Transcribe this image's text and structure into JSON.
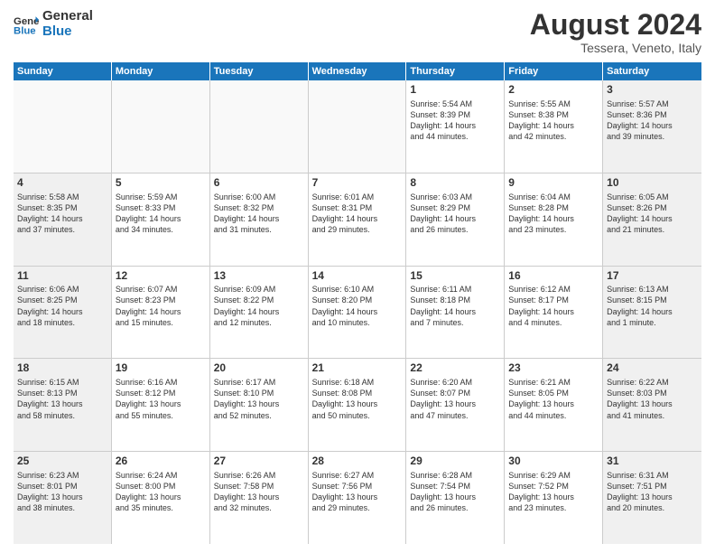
{
  "header": {
    "logo_line1": "General",
    "logo_line2": "Blue",
    "month_year": "August 2024",
    "location": "Tessera, Veneto, Italy"
  },
  "days": [
    "Sunday",
    "Monday",
    "Tuesday",
    "Wednesday",
    "Thursday",
    "Friday",
    "Saturday"
  ],
  "weeks": [
    [
      {
        "day": "",
        "content": ""
      },
      {
        "day": "",
        "content": ""
      },
      {
        "day": "",
        "content": ""
      },
      {
        "day": "",
        "content": ""
      },
      {
        "day": "1",
        "content": "Sunrise: 5:54 AM\nSunset: 8:39 PM\nDaylight: 14 hours\nand 44 minutes."
      },
      {
        "day": "2",
        "content": "Sunrise: 5:55 AM\nSunset: 8:38 PM\nDaylight: 14 hours\nand 42 minutes."
      },
      {
        "day": "3",
        "content": "Sunrise: 5:57 AM\nSunset: 8:36 PM\nDaylight: 14 hours\nand 39 minutes."
      }
    ],
    [
      {
        "day": "4",
        "content": "Sunrise: 5:58 AM\nSunset: 8:35 PM\nDaylight: 14 hours\nand 37 minutes."
      },
      {
        "day": "5",
        "content": "Sunrise: 5:59 AM\nSunset: 8:33 PM\nDaylight: 14 hours\nand 34 minutes."
      },
      {
        "day": "6",
        "content": "Sunrise: 6:00 AM\nSunset: 8:32 PM\nDaylight: 14 hours\nand 31 minutes."
      },
      {
        "day": "7",
        "content": "Sunrise: 6:01 AM\nSunset: 8:31 PM\nDaylight: 14 hours\nand 29 minutes."
      },
      {
        "day": "8",
        "content": "Sunrise: 6:03 AM\nSunset: 8:29 PM\nDaylight: 14 hours\nand 26 minutes."
      },
      {
        "day": "9",
        "content": "Sunrise: 6:04 AM\nSunset: 8:28 PM\nDaylight: 14 hours\nand 23 minutes."
      },
      {
        "day": "10",
        "content": "Sunrise: 6:05 AM\nSunset: 8:26 PM\nDaylight: 14 hours\nand 21 minutes."
      }
    ],
    [
      {
        "day": "11",
        "content": "Sunrise: 6:06 AM\nSunset: 8:25 PM\nDaylight: 14 hours\nand 18 minutes."
      },
      {
        "day": "12",
        "content": "Sunrise: 6:07 AM\nSunset: 8:23 PM\nDaylight: 14 hours\nand 15 minutes."
      },
      {
        "day": "13",
        "content": "Sunrise: 6:09 AM\nSunset: 8:22 PM\nDaylight: 14 hours\nand 12 minutes."
      },
      {
        "day": "14",
        "content": "Sunrise: 6:10 AM\nSunset: 8:20 PM\nDaylight: 14 hours\nand 10 minutes."
      },
      {
        "day": "15",
        "content": "Sunrise: 6:11 AM\nSunset: 8:18 PM\nDaylight: 14 hours\nand 7 minutes."
      },
      {
        "day": "16",
        "content": "Sunrise: 6:12 AM\nSunset: 8:17 PM\nDaylight: 14 hours\nand 4 minutes."
      },
      {
        "day": "17",
        "content": "Sunrise: 6:13 AM\nSunset: 8:15 PM\nDaylight: 14 hours\nand 1 minute."
      }
    ],
    [
      {
        "day": "18",
        "content": "Sunrise: 6:15 AM\nSunset: 8:13 PM\nDaylight: 13 hours\nand 58 minutes."
      },
      {
        "day": "19",
        "content": "Sunrise: 6:16 AM\nSunset: 8:12 PM\nDaylight: 13 hours\nand 55 minutes."
      },
      {
        "day": "20",
        "content": "Sunrise: 6:17 AM\nSunset: 8:10 PM\nDaylight: 13 hours\nand 52 minutes."
      },
      {
        "day": "21",
        "content": "Sunrise: 6:18 AM\nSunset: 8:08 PM\nDaylight: 13 hours\nand 50 minutes."
      },
      {
        "day": "22",
        "content": "Sunrise: 6:20 AM\nSunset: 8:07 PM\nDaylight: 13 hours\nand 47 minutes."
      },
      {
        "day": "23",
        "content": "Sunrise: 6:21 AM\nSunset: 8:05 PM\nDaylight: 13 hours\nand 44 minutes."
      },
      {
        "day": "24",
        "content": "Sunrise: 6:22 AM\nSunset: 8:03 PM\nDaylight: 13 hours\nand 41 minutes."
      }
    ],
    [
      {
        "day": "25",
        "content": "Sunrise: 6:23 AM\nSunset: 8:01 PM\nDaylight: 13 hours\nand 38 minutes."
      },
      {
        "day": "26",
        "content": "Sunrise: 6:24 AM\nSunset: 8:00 PM\nDaylight: 13 hours\nand 35 minutes."
      },
      {
        "day": "27",
        "content": "Sunrise: 6:26 AM\nSunset: 7:58 PM\nDaylight: 13 hours\nand 32 minutes."
      },
      {
        "day": "28",
        "content": "Sunrise: 6:27 AM\nSunset: 7:56 PM\nDaylight: 13 hours\nand 29 minutes."
      },
      {
        "day": "29",
        "content": "Sunrise: 6:28 AM\nSunset: 7:54 PM\nDaylight: 13 hours\nand 26 minutes."
      },
      {
        "day": "30",
        "content": "Sunrise: 6:29 AM\nSunset: 7:52 PM\nDaylight: 13 hours\nand 23 minutes."
      },
      {
        "day": "31",
        "content": "Sunrise: 6:31 AM\nSunset: 7:51 PM\nDaylight: 13 hours\nand 20 minutes."
      }
    ]
  ]
}
